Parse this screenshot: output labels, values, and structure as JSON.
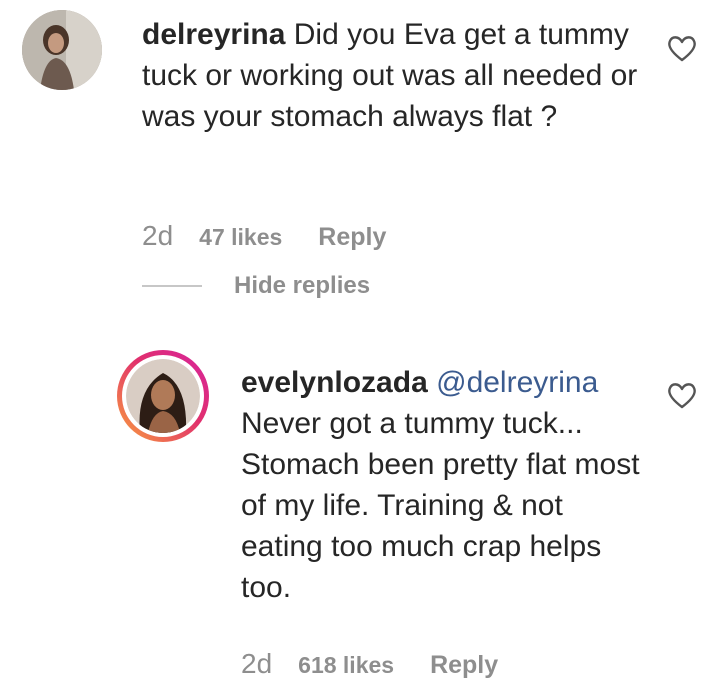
{
  "comment": {
    "username": "delreyrina",
    "text": "Did you Eva get a tummy tuck or working out was all needed or was your stomach always flat ?",
    "time": "2d",
    "likes": "47 likes",
    "reply_label": "Reply",
    "icon": "heart-icon"
  },
  "hide_replies_label": "Hide replies",
  "reply": {
    "username": "evelynlozada",
    "mention": "@delreyrina",
    "text": "Never got a tummy tuck... Stomach been pretty flat most of my life. Training & not eating too much crap helps too.",
    "time": "2d",
    "likes": "618 likes",
    "reply_label": "Reply",
    "icon": "heart-icon"
  },
  "colors": {
    "text": "#262626",
    "muted": "#8e8e8e",
    "mention": "#3b5b8f",
    "story_ring_start": "#f9a13d",
    "story_ring_end": "#d6249f"
  }
}
